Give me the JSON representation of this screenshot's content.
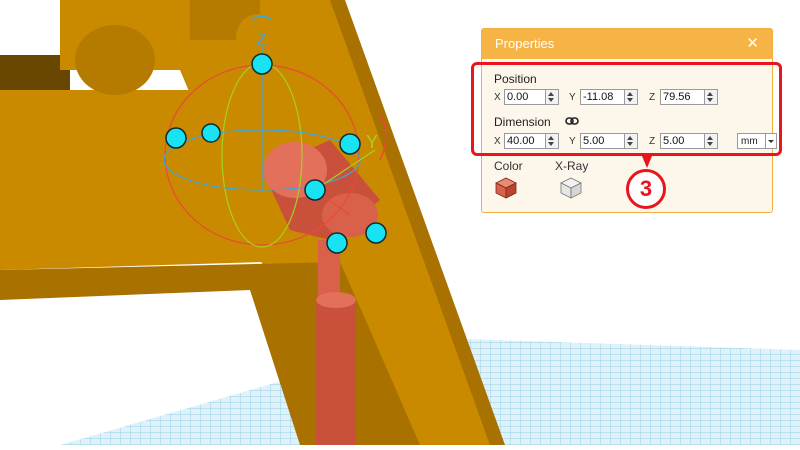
{
  "properties_panel": {
    "title": "Properties",
    "close_glyph": "✕",
    "position": {
      "label": "Position",
      "x_axis": "X",
      "x_value": "0.00",
      "y_axis": "Y",
      "y_value": "-11.08",
      "z_axis": "Z",
      "z_value": "79.56"
    },
    "dimension": {
      "label": "Dimension",
      "link_icon": "link-icon",
      "x_axis": "X",
      "x_value": "40.00",
      "y_axis": "Y",
      "y_value": "5.00",
      "z_axis": "Z",
      "z_value": "5.00",
      "unit": "mm"
    },
    "color_label": "Color",
    "color_icon": "color-cube-icon",
    "color_hex": "#d9604a",
    "xray_label": "X-Ray",
    "xray_icon": "xray-cube-icon"
  },
  "viewport": {
    "gizmo_axis_z": "Z",
    "gizmo_axis_y": "Y",
    "bed_color": "#bfe3f2",
    "part_color": "#c98a00",
    "selected_part_color": "#d9604a"
  },
  "annotation": {
    "callout_number": "3",
    "highlight_color": "#e8151d"
  }
}
